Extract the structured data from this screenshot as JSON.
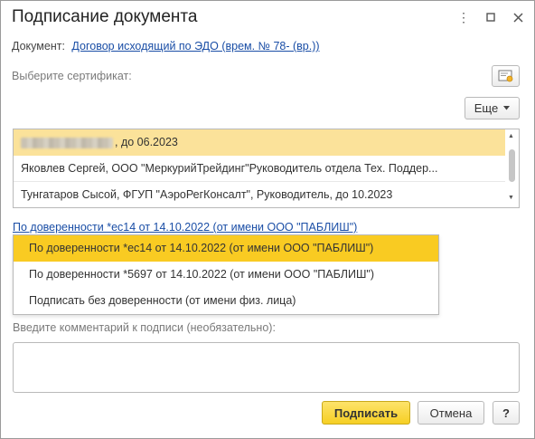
{
  "window": {
    "title": "Подписание документа",
    "controls": {
      "more_icon": "⋮",
      "maximize_icon": "☐",
      "close_icon": "✕"
    }
  },
  "document": {
    "label": "Документ:",
    "value": "Договор исходящий по ЭДО (врем. № 78- (вр.))"
  },
  "certificates": {
    "label": "Выберите сертификат:",
    "more_button": "Еще",
    "items": [
      {
        "text": ", до 06.2023",
        "redacted": true,
        "selected": true
      },
      {
        "text": "Яковлев Сергей, ООО \"МеркурийТрейдинг\"Руководитель отдела Тех. Поддер...",
        "selected": false
      },
      {
        "text": "Тунгатаров Сысой, ФГУП \"АэроРегКонсалт\", Руководитель, до 10.2023",
        "selected": false
      }
    ]
  },
  "proxy": {
    "link": "По доверенности *ес14 от 14.10.2022 (от имени ООО \"ПАБЛИШ\")",
    "options": [
      {
        "text": "По доверенности *ес14 от 14.10.2022 (от имени ООО \"ПАБЛИШ\")",
        "selected": true
      },
      {
        "text": "По доверенности *5697 от 14.10.2022 (от имени ООО \"ПАБЛИШ\")",
        "selected": false
      },
      {
        "text": "Подписать без доверенности (от имени физ. лица)",
        "selected": false
      }
    ]
  },
  "comment": {
    "label": "Введите комментарий к подписи (необязательно):",
    "value": ""
  },
  "buttons": {
    "sign": "Подписать",
    "cancel": "Отмена",
    "help": "?"
  },
  "colors": {
    "selection_light": "#fbe29a",
    "selection_strong": "#f9cb22",
    "link": "#1a4ea6",
    "primary_button": "#f6cf24"
  }
}
